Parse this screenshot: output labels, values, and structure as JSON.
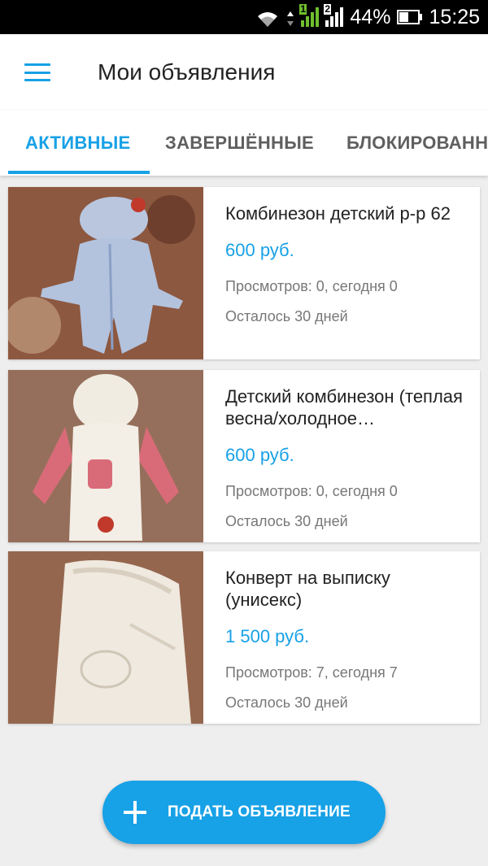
{
  "status_bar": {
    "sim1_label": "1",
    "sim2_label": "2",
    "battery_percent": "44%",
    "time": "15:25",
    "battery_level": 0.44
  },
  "app_bar": {
    "title": "Мои объявления",
    "menu_icon": "hamburger-menu-icon"
  },
  "tabs": [
    {
      "label": "АКТИВНЫЕ",
      "active": true
    },
    {
      "label": "ЗАВЕРШЁННЫЕ",
      "active": false
    },
    {
      "label": "БЛОКИРОВАННЫЕ",
      "active": false
    }
  ],
  "listings": [
    {
      "title": "Комбинезон детский р-р 62",
      "price": "600 руб.",
      "views": "Просмотров: 0, сегодня 0",
      "remaining": "Осталось 30 дней"
    },
    {
      "title": "Детский комбинезон (теплая весна/холодное…",
      "price": "600 руб.",
      "views": "Просмотров: 0, сегодня 0",
      "remaining": "Осталось 30 дней"
    },
    {
      "title": "Конверт на выписку (унисекс)",
      "price": "1 500 руб.",
      "views": "Просмотров: 7, сегодня 7",
      "remaining": "Осталось 30 дней"
    }
  ],
  "fab": {
    "label": "ПОДАТЬ ОБЪЯВЛЕНИЕ",
    "icon": "plus-icon"
  },
  "colors": {
    "accent": "#17a1e6",
    "background": "#eeeeee",
    "status_bar": "#000000"
  }
}
